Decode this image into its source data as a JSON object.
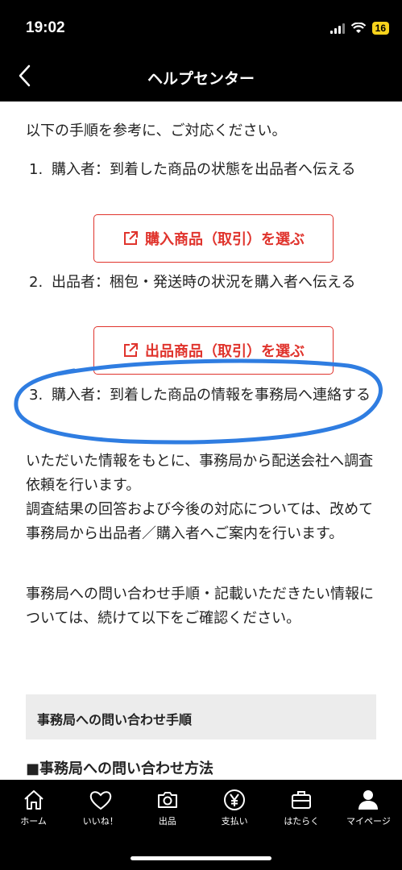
{
  "status": {
    "time": "19:02",
    "battery": "16"
  },
  "nav": {
    "title": "ヘルプセンター"
  },
  "content": {
    "intro": "以下の手順を参考に、ご対応ください。",
    "steps": [
      {
        "num": "1.",
        "text": "購入者：到着した商品の状態を出品者へ伝える"
      },
      {
        "num": "2.",
        "text": "出品者：梱包・発送時の状況を購入者へ伝える"
      },
      {
        "num": "3.",
        "text": "購入者：到着した商品の情報を事務局へ連絡する"
      }
    ],
    "buttons": [
      {
        "label": "購入商品（取引）を選ぶ"
      },
      {
        "label": "出品商品（取引）を選ぶ"
      }
    ],
    "para1": "いただいた情報をもとに、事務局から配送会社へ調査依頼を行います。\n調査結果の回答および今後の対応については、改めて事務局から出品者／購入者へご案内を行います。",
    "para2": "事務局への問い合わせ手順・記載いただきたい情報については、続けて以下をご確認ください。",
    "section_title": "事務局への問い合わせ手順",
    "sub_heading": "■事務局への問い合わせ方法",
    "highlight_color": "#2f7de1"
  },
  "tabs": [
    {
      "label": "ホーム",
      "icon": "home-icon"
    },
    {
      "label": "いいね！",
      "icon": "heart-icon"
    },
    {
      "label": "出品",
      "icon": "camera-icon"
    },
    {
      "label": "支払い",
      "icon": "yen-icon"
    },
    {
      "label": "はたらく",
      "icon": "briefcase-icon"
    },
    {
      "label": "マイページ",
      "icon": "person-icon"
    }
  ],
  "colors": {
    "accent": "#e0342d",
    "bar": "#000000"
  }
}
